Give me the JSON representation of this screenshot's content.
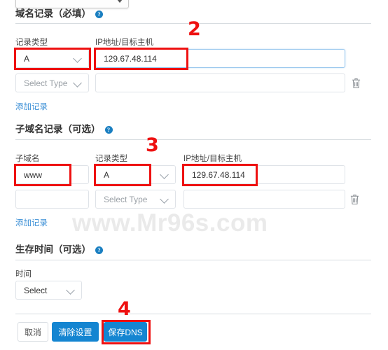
{
  "page": {
    "watermark": "www.Mr96s.com"
  },
  "top_select": {
    "value": "",
    "icon": "triangle-down-icon"
  },
  "sections": [
    {
      "id": "domain-records",
      "title": "域名记录（必填）",
      "help_icon": "question-mark-icon",
      "help_glyph": "?",
      "columns": [
        "记录类型",
        "IP地址/目标主机"
      ],
      "rows": [
        {
          "type_value": "A",
          "type_is_placeholder": false,
          "host_value": "129.67.48.114",
          "host_placeholder": "",
          "host_focused": true,
          "has_trash": false
        },
        {
          "type_value": "Select Type",
          "type_is_placeholder": true,
          "host_value": "",
          "host_placeholder": "",
          "host_focused": false,
          "has_trash": true
        }
      ],
      "add_link": "添加记录"
    },
    {
      "id": "subdomain-records",
      "title": "子域名记录（可选）",
      "help_icon": "question-mark-icon",
      "help_glyph": "?",
      "columns": [
        "子域名",
        "记录类型",
        "IP地址/目标主机"
      ],
      "rows": [
        {
          "subdomain_value": "www",
          "type_value": "A",
          "type_is_placeholder": false,
          "host_value": "129.67.48.114",
          "host_focused": false,
          "has_trash": false
        },
        {
          "subdomain_value": "",
          "type_value": "Select Type",
          "type_is_placeholder": true,
          "host_value": "",
          "host_focused": false,
          "has_trash": true
        }
      ],
      "add_link": "添加记录"
    },
    {
      "id": "ttl",
      "title": "生存时间（可选）",
      "help_icon": "question-mark-icon",
      "help_glyph": "?",
      "columns": [
        "时间"
      ],
      "select_value": "Select"
    }
  ],
  "footer": {
    "cancel_label": "取消",
    "clear_label": "清除设置",
    "save_label": "保存DNS"
  },
  "annotations": {
    "numbers": [
      "2",
      "3",
      "4"
    ],
    "color": "#ee1111"
  },
  "icons": {
    "trash": "trash-icon",
    "chevron_down": "chevron-down-icon"
  }
}
